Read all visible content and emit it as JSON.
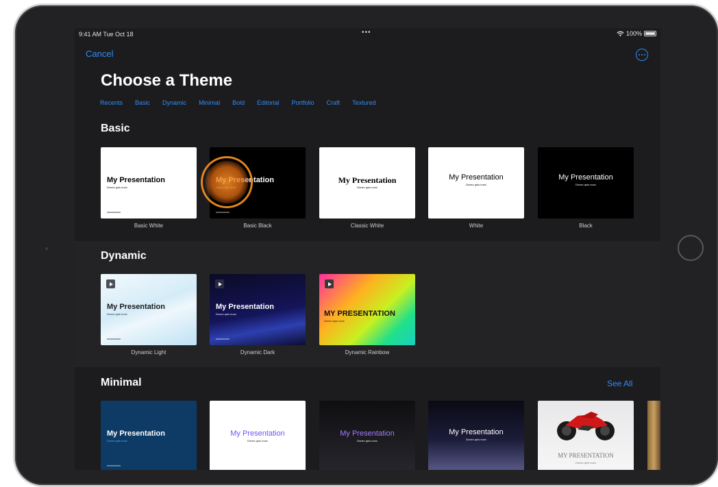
{
  "status_bar": {
    "time": "9:41 AM  Tue Oct 18",
    "dots": "•••",
    "battery": "100%"
  },
  "nav": {
    "cancel": "Cancel",
    "more_icon": "ellipsis-circle-icon"
  },
  "title": "Choose a Theme",
  "categories": [
    "Recents",
    "Basic",
    "Dynamic",
    "Minimal",
    "Bold",
    "Editorial",
    "Portfolio",
    "Craft",
    "Textured"
  ],
  "sections": {
    "basic": {
      "title": "Basic",
      "themes": [
        {
          "label": "Basic White",
          "thumb_title": "My Presentation",
          "thumb_sub": "Donec quis nunc"
        },
        {
          "label": "Basic Black",
          "thumb_title": "My Presentation",
          "thumb_sub": "Donec quis nunc"
        },
        {
          "label": "Classic White",
          "thumb_title": "My Presentation",
          "thumb_sub": "Donec quis nunc"
        },
        {
          "label": "White",
          "thumb_title": "My Presentation",
          "thumb_sub": "Donec quis nunc"
        },
        {
          "label": "Black",
          "thumb_title": "My Presentation",
          "thumb_sub": "Donec quis nunc"
        }
      ]
    },
    "dynamic": {
      "title": "Dynamic",
      "themes": [
        {
          "label": "Dynamic Light",
          "thumb_title": "My Presentation",
          "thumb_sub": "Donec quis nunc"
        },
        {
          "label": "Dynamic Dark",
          "thumb_title": "My Presentation",
          "thumb_sub": "Donec quis nunc"
        },
        {
          "label": "Dynamic Rainbow",
          "thumb_title": "MY PRESENTATION",
          "thumb_sub": "Donec quis nunc"
        }
      ]
    },
    "minimal": {
      "title": "Minimal",
      "see_all": "See All",
      "themes": [
        {
          "thumb_title": "My Presentation",
          "thumb_sub": "Donec quis nunc"
        },
        {
          "thumb_title": "My Presentation",
          "thumb_sub": "Donec quis nunc"
        },
        {
          "thumb_title": "My Presentation",
          "thumb_sub": "Donec quis nunc"
        },
        {
          "thumb_title": "My Presentation",
          "thumb_sub": "Donec quis nunc"
        },
        {
          "thumb_title": "MY PRESENTATION",
          "thumb_sub": "Donec quis nunc"
        }
      ]
    }
  },
  "colors": {
    "accent": "#2f8cf7",
    "background": "#1c1c1e",
    "touch_indicator": "#f08c1e"
  }
}
